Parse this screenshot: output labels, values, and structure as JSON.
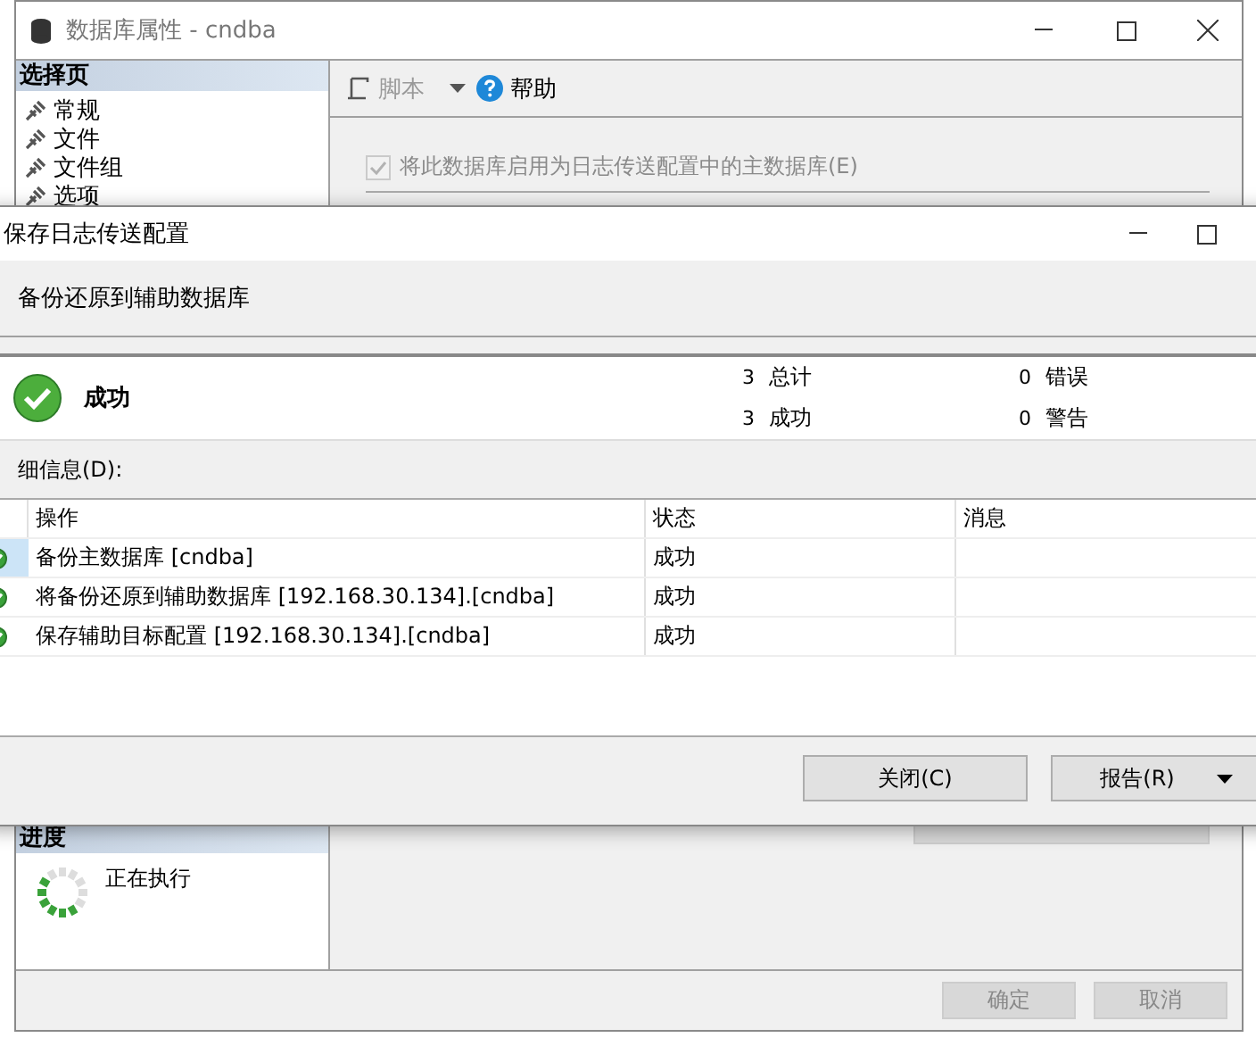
{
  "background_window": {
    "title": "数据库属性 - cndba",
    "select_page": {
      "heading": "选择页",
      "items": [
        {
          "label": "常规"
        },
        {
          "label": "文件"
        },
        {
          "label": "文件组"
        },
        {
          "label": "选项"
        }
      ]
    },
    "toolbar": {
      "script": {
        "label": "脚本",
        "disabled": true
      },
      "help": {
        "label": "帮助"
      }
    },
    "primary_checkbox": {
      "label": "将此数据库启用为日志传送配置中的主数据库(E)",
      "checked": true,
      "disabled": true
    },
    "script_dropdown": {
      "disabled": true
    },
    "progress": {
      "heading": "进度",
      "status": "正在执行"
    },
    "buttons": [
      {
        "label": "确定",
        "disabled": true
      },
      {
        "label": "取消",
        "disabled": true
      }
    ]
  },
  "dialog": {
    "title": "保存日志传送配置",
    "step": "备份还原到辅助数据库",
    "result": {
      "kind": "success",
      "label": "成功"
    },
    "counts": [
      {
        "value": "3",
        "label": "总计"
      },
      {
        "value": "3",
        "label": "成功"
      },
      {
        "value": "0",
        "label": "错误"
      },
      {
        "value": "0",
        "label": "警告"
      }
    ],
    "details_label": "细信息(D):",
    "table": {
      "columns": [
        "操作",
        "状态",
        "消息"
      ],
      "rows": [
        {
          "kind": "success",
          "action": "备份主数据库 [cndba]",
          "status": "成功",
          "selected": true
        },
        {
          "kind": "success",
          "action": "将备份还原到辅助数据库 [192.168.30.134].[cndba]",
          "status": "成功",
          "selected": false
        },
        {
          "kind": "success",
          "action": "保存辅助目标配置 [192.168.30.134].[cndba]",
          "status": "成功",
          "selected": false
        }
      ]
    },
    "buttons": [
      {
        "label": "关闭(C)",
        "dropdown": false
      },
      {
        "label": "报告(R)",
        "dropdown": true
      }
    ]
  }
}
